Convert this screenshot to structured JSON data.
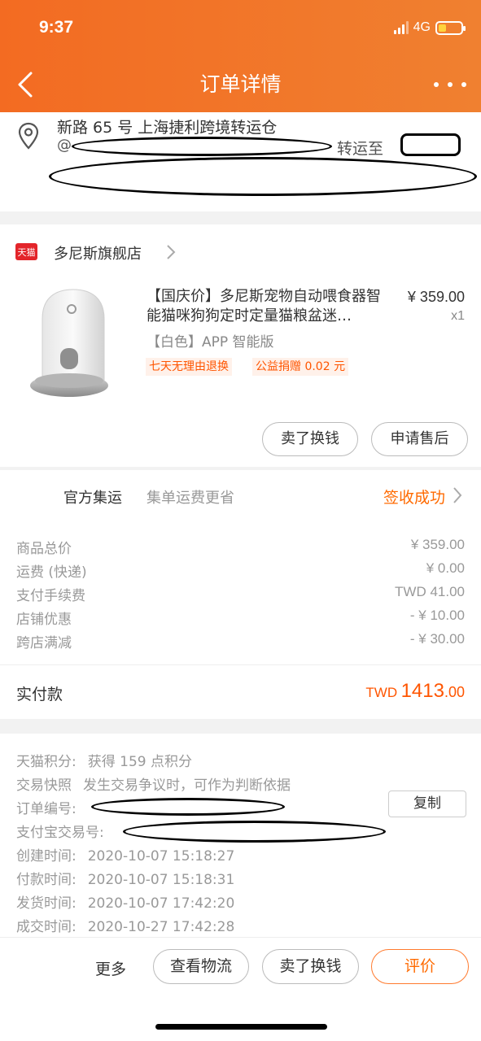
{
  "status_bar": {
    "time": "9:37",
    "network": "4G"
  },
  "nav": {
    "title": "订单详情"
  },
  "address": {
    "line1": "新路 65 号  上海捷利跨境转运仓",
    "line2_prefix": "@",
    "transfer_label": "转运至"
  },
  "shop": {
    "badge": "天猫",
    "name": "多尼斯旗舰店"
  },
  "product": {
    "title": "【国庆价】多尼斯宠物自动喂食器智能猫咪狗狗定时定量猫粮盆迷…",
    "price": "¥ 359.00",
    "qty": "x1",
    "sku": "【白色】APP 智能版",
    "tags": [
      "七天无理由退换",
      "公益捐赠 0.02 元"
    ],
    "actions": [
      "卖了换钱",
      "申请售后"
    ]
  },
  "shipping": {
    "label": "官方集运",
    "desc": "集单运费更省",
    "status": "签收成功"
  },
  "costs": [
    {
      "label": "商品总价",
      "value": "¥ 359.00"
    },
    {
      "label": "运费 (快递)",
      "value": "¥ 0.00"
    },
    {
      "label": "支付手续费",
      "value": "TWD 41.00"
    },
    {
      "label": "店铺优惠",
      "value": "- ¥ 10.00"
    },
    {
      "label": "跨店满减",
      "value": "- ¥ 30.00"
    }
  ],
  "paid": {
    "label": "实付款",
    "currency": "TWD",
    "integer": "1413",
    "decimal": ".00"
  },
  "info": {
    "points_label": "天猫积分:",
    "points_value": "获得 159 点积分",
    "snapshot_label": "交易快照",
    "snapshot_value": "发生交易争议时，可作为判断依据",
    "order_no_label": "订单编号:",
    "copy_label": "复制",
    "alipay_label": "支付宝交易号:",
    "times": [
      {
        "label": "创建时间:",
        "value": "2020-10-07 15:18:27"
      },
      {
        "label": "付款时间:",
        "value": "2020-10-07 15:18:31"
      },
      {
        "label": "发货时间:",
        "value": "2020-10-07 17:42:20"
      },
      {
        "label": "成交时间:",
        "value": "2020-10-27 17:42:28"
      }
    ]
  },
  "bottom_bar": {
    "more": "更多",
    "logistics": "查看物流",
    "sell": "卖了换钱",
    "review": "评价"
  },
  "colors": {
    "brand_orange": "#f36b22",
    "price_orange": "#ff5500",
    "tmall_red": "#e3252a"
  },
  "icons": [
    "back-arrow-icon",
    "more-dots-icon",
    "location-pin-icon",
    "chevron-right-icon",
    "tmall-badge-icon"
  ]
}
